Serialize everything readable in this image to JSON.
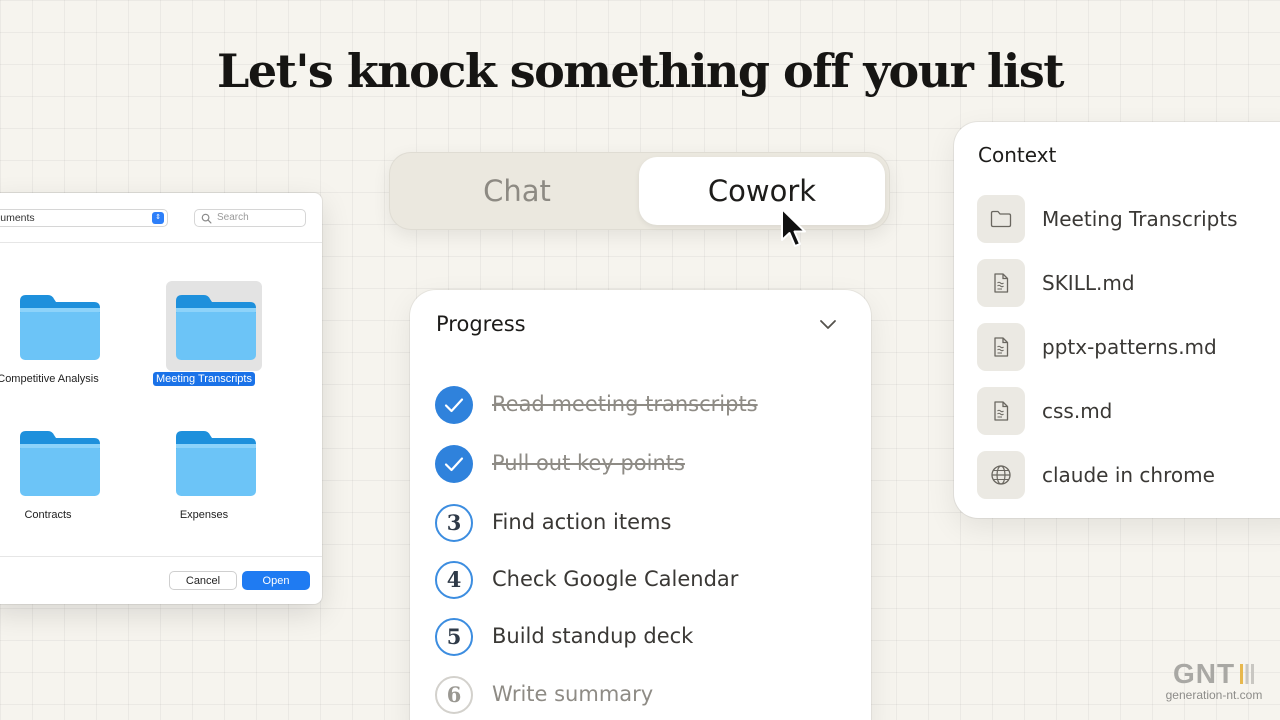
{
  "headline": "Let's knock something off your list",
  "file_dialog": {
    "location": "cuments",
    "search_placeholder": "Search",
    "folders": [
      {
        "name": "Competitive Analysis",
        "selected": false
      },
      {
        "name": "Meeting Transcripts",
        "selected": true
      },
      {
        "name": "Contracts",
        "selected": false
      },
      {
        "name": "Expenses",
        "selected": false
      }
    ],
    "cancel_label": "Cancel",
    "open_label": "Open"
  },
  "mode_toggle": {
    "options": [
      "Chat",
      "Cowork"
    ],
    "active": "Cowork"
  },
  "progress": {
    "title": "Progress",
    "steps": [
      {
        "label": "Read meeting transcripts",
        "status": "done"
      },
      {
        "label": "Pull out key points",
        "status": "done"
      },
      {
        "label": "Find action items",
        "status": "active",
        "number": "3"
      },
      {
        "label": "Check Google Calendar",
        "status": "active",
        "number": "4"
      },
      {
        "label": "Build standup deck",
        "status": "active",
        "number": "5"
      },
      {
        "label": "Write summary",
        "status": "pending",
        "number": "6"
      }
    ]
  },
  "context": {
    "title": "Context",
    "items": [
      {
        "label": "Meeting Transcripts",
        "icon": "folder-icon"
      },
      {
        "label": "SKILL.md",
        "icon": "document-icon"
      },
      {
        "label": "pptx-patterns.md",
        "icon": "document-icon"
      },
      {
        "label": "css.md",
        "icon": "document-icon"
      },
      {
        "label": "claude in chrome",
        "icon": "globe-icon"
      }
    ]
  },
  "watermark": {
    "logo": "GNT",
    "url": "generation-nt.com"
  },
  "colors": {
    "background": "#f6f4ee",
    "accent_blue": "#2f82dc",
    "macos_blue": "#1f7bf2",
    "folder_blue": "#6cc4f7"
  }
}
